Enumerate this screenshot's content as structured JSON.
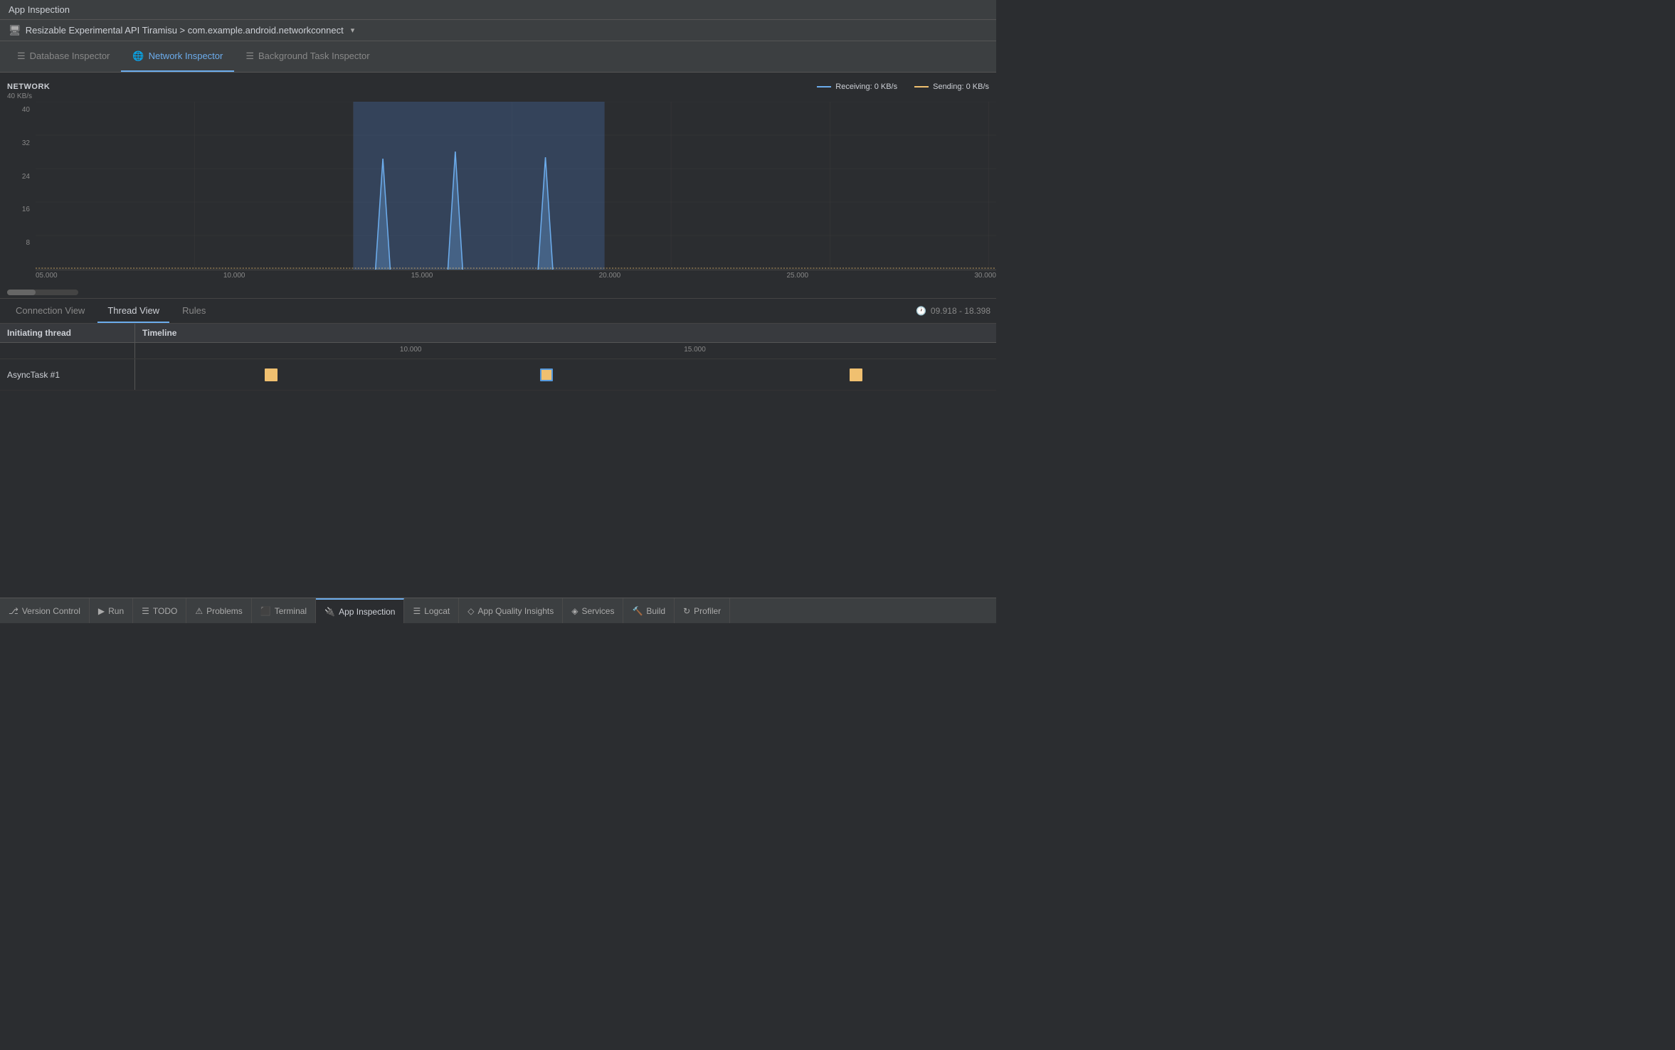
{
  "title_bar": {
    "label": "App Inspection"
  },
  "device_bar": {
    "icon": "📱",
    "label": "Resizable Experimental API Tiramisu > com.example.android.networkconnect",
    "chevron": "▾"
  },
  "inspector_tabs": [
    {
      "id": "database",
      "label": "Database Inspector",
      "icon": "☰",
      "active": false
    },
    {
      "id": "network",
      "label": "Network Inspector",
      "icon": "🌐",
      "active": true
    },
    {
      "id": "background",
      "label": "Background Task Inspector",
      "icon": "☰",
      "active": false
    }
  ],
  "chart": {
    "title": "NETWORK",
    "y_axis_top": "40 KB/s",
    "y_labels": [
      "40",
      "32",
      "24",
      "16",
      "8",
      ""
    ],
    "x_labels": [
      "05.000",
      "10.000",
      "15.000",
      "20.000",
      "25.000",
      "30.000"
    ],
    "legend_receiving": "Receiving: 0 KB/s",
    "legend_sending": "Sending: 0 KB/s"
  },
  "view_tabs": [
    {
      "id": "connection",
      "label": "Connection View",
      "active": false
    },
    {
      "id": "thread",
      "label": "Thread View",
      "active": true
    },
    {
      "id": "rules",
      "label": "Rules",
      "active": false
    }
  ],
  "time_range": "09.918 - 18.398",
  "thread_table": {
    "col1": "Initiating thread",
    "col2": "Timeline",
    "timeline_ticks": [
      "10.000",
      "15.000"
    ],
    "rows": [
      {
        "name": "AsyncTask #1",
        "tasks": [
          {
            "position_pct": 15,
            "selected": false
          },
          {
            "position_pct": 47,
            "selected": true
          },
          {
            "position_pct": 83,
            "selected": false
          }
        ]
      }
    ]
  },
  "bottom_toolbar": [
    {
      "id": "version-control",
      "icon": "⎇",
      "label": "Version Control",
      "active": false
    },
    {
      "id": "run",
      "icon": "▶",
      "label": "Run",
      "active": false
    },
    {
      "id": "todo",
      "icon": "☰",
      "label": "TODO",
      "active": false
    },
    {
      "id": "problems",
      "icon": "⚠",
      "label": "Problems",
      "active": false
    },
    {
      "id": "terminal",
      "icon": "⬜",
      "label": "Terminal",
      "active": false
    },
    {
      "id": "app-inspection",
      "icon": "🔌",
      "label": "App Inspection",
      "active": true
    },
    {
      "id": "logcat",
      "icon": "☰",
      "label": "Logcat",
      "active": false
    },
    {
      "id": "app-quality",
      "icon": "◇",
      "label": "App Quality Insights",
      "active": false
    },
    {
      "id": "services",
      "icon": "◈",
      "label": "Services",
      "active": false
    },
    {
      "id": "build",
      "icon": "🔨",
      "label": "Build",
      "active": false
    },
    {
      "id": "profiler",
      "icon": "↻",
      "label": "Profiler",
      "active": false
    }
  ]
}
